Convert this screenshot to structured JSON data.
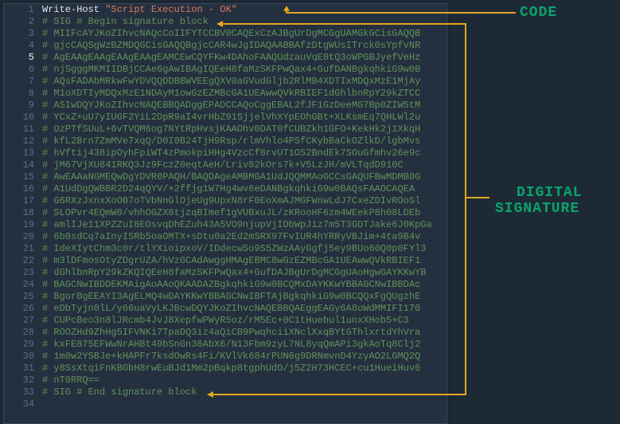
{
  "annotations": {
    "code_label": "CODE",
    "sig_label_line1": "DIGITAL",
    "sig_label_line2": "SIGNATURE"
  },
  "code_lines": [
    {
      "n": 1,
      "hl": false,
      "tokens": [
        {
          "cls": "tok-cmd",
          "text": "Write-Host"
        },
        {
          "cls": "",
          "text": " "
        },
        {
          "cls": "tok-str",
          "text": "\"Script Execution - OK\""
        }
      ]
    },
    {
      "n": 2,
      "hl": false,
      "tokens": [
        {
          "cls": "tok-cmt",
          "text": "# SIG # Begin signature block"
        }
      ]
    },
    {
      "n": 3,
      "hl": false,
      "tokens": [
        {
          "cls": "tok-cmt",
          "text": "# MIIFcAYJKoZIhvcNAQcCoIIFYTCCBV0CAQExCzAJBgUrDgMCGgUAMGkGCisGAQQB"
        }
      ]
    },
    {
      "n": 4,
      "hl": false,
      "tokens": [
        {
          "cls": "tok-cmt",
          "text": "# gjcCAQSgWzBZMDQGCisGAQQBgjcCAR4wJgIDAQAABBAfzDtgWUsITrck0sYpfvNR"
        }
      ]
    },
    {
      "n": 5,
      "hl": true,
      "tokens": [
        {
          "cls": "tok-cmt",
          "text": "# AgEAAgEAAgEAAgEAAgEAMCEwCQYFKw4DAhoFAAQUdzauVqE8tQ3oWPGBJyefVeHz"
        }
      ]
    },
    {
      "n": 6,
      "hl": false,
      "tokens": [
        {
          "cls": "tok-cmt",
          "text": "# njSgggMKMIIDBjCCAe6gAwIBAgIQEeH8faMzSKFPwQax4+GufDANBgkqhkiG9w0B"
        }
      ]
    },
    {
      "n": 7,
      "hl": false,
      "tokens": [
        {
          "cls": "tok-cmt",
          "text": "# AQsFADAbMRkwFwYDVQQDDBBWVEEgQXV0aGVudGljb2RlMB4XDTIxMDQxMzE1MjAy"
        }
      ]
    },
    {
      "n": 8,
      "hl": false,
      "tokens": [
        {
          "cls": "tok-cmt",
          "text": "# M1oXDTIyMDQxMzE1NDAyM1owGzEZMBcGA1UEAwwQVkRBIEF1dGhlbnRpY29kZTCC"
        }
      ]
    },
    {
      "n": 9,
      "hl": false,
      "tokens": [
        {
          "cls": "tok-cmt",
          "text": "# ASIwDQYJKoZIhvcNAQEBBQADggEPADCCAQoCggEBAL2fJF1GzDeeMG7Bp0ZIW5tM"
        }
      ]
    },
    {
      "n": 10,
      "hl": false,
      "tokens": [
        {
          "cls": "tok-cmt",
          "text": "# YCxZ+uU7yIUGF2YiL2DpR9aI4vrHbZ91SjjelVhXYpEOhGBt+XLKsmEq7QHLWl2u"
        }
      ]
    },
    {
      "n": 11,
      "hl": false,
      "tokens": [
        {
          "cls": "tok-cmt",
          "text": "# OzPTfSUuL+6vTVQM6og7NYtRpHvsjKAAOhv0DAT0fCUBZkh1GFO+KekHk2j1XkqH"
        }
      ]
    },
    {
      "n": 12,
      "hl": false,
      "tokens": [
        {
          "cls": "tok-cmt",
          "text": "# kfL2Brn7ZmMVe7xqQ/D0I0B24TjH9Rsp/rlmVhlo4PSfCKybBaCkOZlkD/lgbMvs"
        }
      ]
    },
    {
      "n": 13,
      "hl": false,
      "tokens": [
        {
          "cls": "tok-cmt",
          "text": "# hVftij438ipOyhFpiWT4zPmokpiHHg4VzcCf8rvUT1OS2BndEk7SOuGfmhv26e9c"
        }
      ]
    },
    {
      "n": 14,
      "hl": false,
      "tokens": [
        {
          "cls": "tok-cmt",
          "text": "# jM67VjXU841RKQ3Jz9FczZ0eqtAeH/Lriv82kOrs7k+V5LzJH/mVLTqdD910C"
        }
      ]
    },
    {
      "n": 15,
      "hl": false,
      "tokens": [
        {
          "cls": "tok-cmt",
          "text": "# AwEAAaNGMEQwDgYDVR0PAQH/BAQDAgeAMBMGA1UdJQQMMAoGCCsGAQUFBwMDMB0G"
        }
      ]
    },
    {
      "n": 16,
      "hl": false,
      "tokens": [
        {
          "cls": "tok-cmt",
          "text": "# A1UdDgQWBBR2D24qQYV/+2ffjg1W7Hg4wv6eDANBgkqhkiG9w0BAQsFAAOCAQEA"
        }
      ]
    },
    {
      "n": 17,
      "hl": false,
      "tokens": [
        {
          "cls": "tok-cmt",
          "text": "# G6RXzJxnxXoOB7oTVbNnGlOjeUg9UpxN8rF0EoXmAJMGFWnwLdJ7CxeZDIvROoSl"
        }
      ]
    },
    {
      "n": 18,
      "hl": false,
      "tokens": [
        {
          "cls": "tok-cmt",
          "text": "# SLOPvr4EQmW8/vhhOGZX8tjzqBImef1gVUBxuJL/zKRooHF6zm4WEekP8h08LDEb"
        }
      ]
    },
    {
      "n": 19,
      "hl": false,
      "tokens": [
        {
          "cls": "tok-cmt",
          "text": "# amlIJe11XPZZuI8EOsvqDhEZuh43A5VO9njupVjIDbWpJiz7m5T3GDTJake6J0KpGa"
        }
      ]
    },
    {
      "n": 20,
      "hl": false,
      "tokens": [
        {
          "cls": "tok-cmt",
          "text": "# 6b0sdCq7aInyISRb5oaOMTX+sDtu0a2Ed2mSRX97FvIUR4hYRRyVBJim+4ta9B4v"
        }
      ]
    },
    {
      "n": 21,
      "hl": false,
      "tokens": [
        {
          "cls": "tok-cmt",
          "text": "# IdeXIytChm3c0r/tlYXioipxoV/IDdecwSo9S5ZWzAAyGgfj5ey9BUo60Q0p0FYl3"
        }
      ]
    },
    {
      "n": 22,
      "hl": false,
      "tokens": [
        {
          "cls": "tok-cmt",
          "text": "# m3lDFmosOtyZDgrUZA/hVzGCAdAwggHMAgEBMC8wGzEZMBcGA1UEAwwQVkRBIEF1"
        }
      ]
    },
    {
      "n": 23,
      "hl": false,
      "tokens": [
        {
          "cls": "tok-cmt",
          "text": "# dGhlbnRpY29kZKQIQEeH8faMzSKFPwQax4+GufDAJBgUrDgMCGgUAoHgwGAYKKwYB"
        }
      ]
    },
    {
      "n": 24,
      "hl": false,
      "tokens": [
        {
          "cls": "tok-cmt",
          "text": "# BAGCNwIBDDEKMAigAoAAoQKAADAZBgkqhkiG9w0BCQMxDAYKKwYBBAGCNwIBBDAc"
        }
      ]
    },
    {
      "n": 25,
      "hl": false,
      "tokens": [
        {
          "cls": "tok-cmt",
          "text": "# BgorBgEEAYI3AgELMQ4wDAYKKwYBBAGCNwIBFTAjBgkqhkiG9w0BCQQxFgQUgzhE"
        }
      ]
    },
    {
      "n": 26,
      "hl": false,
      "tokens": [
        {
          "cls": "tok-cmt",
          "text": "# eDbTyjn0lL/y66uaVyLKJBcwDQYJKoZIhvcNAQEBBQAEggEAGy6A8oWdMMIFI170"
        }
      ]
    },
    {
      "n": 27,
      "hl": false,
      "tokens": [
        {
          "cls": "tok-cmt",
          "text": "# CUPcBeo3n8lJRcmb4JvJ8XepfwPWyR5oz/rM5Ec+0C1tHuebul1unxXHob5+C3"
        }
      ]
    },
    {
      "n": 28,
      "hl": false,
      "tokens": [
        {
          "cls": "tok-cmt",
          "text": "# ROOZHd9ZhHg5IFVNKi7TpaDQ3iz4aQiCB9PwqhciiXNclXxqBYtGThlxrtdYhVra"
        }
      ]
    },
    {
      "n": 29,
      "hl": false,
      "tokens": [
        {
          "cls": "tok-cmt",
          "text": "# kxFE875EFWwNrAHBt49bSnGn36AbX6/N13Fbm9zyL7NL8yqQmAPi3gkAoTq8Clj2"
        }
      ]
    },
    {
      "n": 30,
      "hl": false,
      "tokens": [
        {
          "cls": "tok-cmt",
          "text": "# 1m0w2YSBJe+kHAPFr7ksdOwRs4Fi/KVlVk684rPUN6g9DRNmvnD4YzyAO2LGMQ2Q"
        }
      ]
    },
    {
      "n": 31,
      "hl": false,
      "tokens": [
        {
          "cls": "tok-cmt",
          "text": "# y8SsXtqiFnKBGbH8rwEuBJd1Mm2pBqkp8tgphUdO/j5Z2H73HCEC+cu1HueiHuv6"
        }
      ]
    },
    {
      "n": 32,
      "hl": false,
      "tokens": [
        {
          "cls": "tok-cmt",
          "text": "# nT0RRQ=="
        }
      ]
    },
    {
      "n": 33,
      "hl": false,
      "tokens": [
        {
          "cls": "tok-cmt",
          "text": "# SIG # End signature block"
        }
      ]
    },
    {
      "n": 34,
      "hl": false,
      "tokens": []
    }
  ]
}
